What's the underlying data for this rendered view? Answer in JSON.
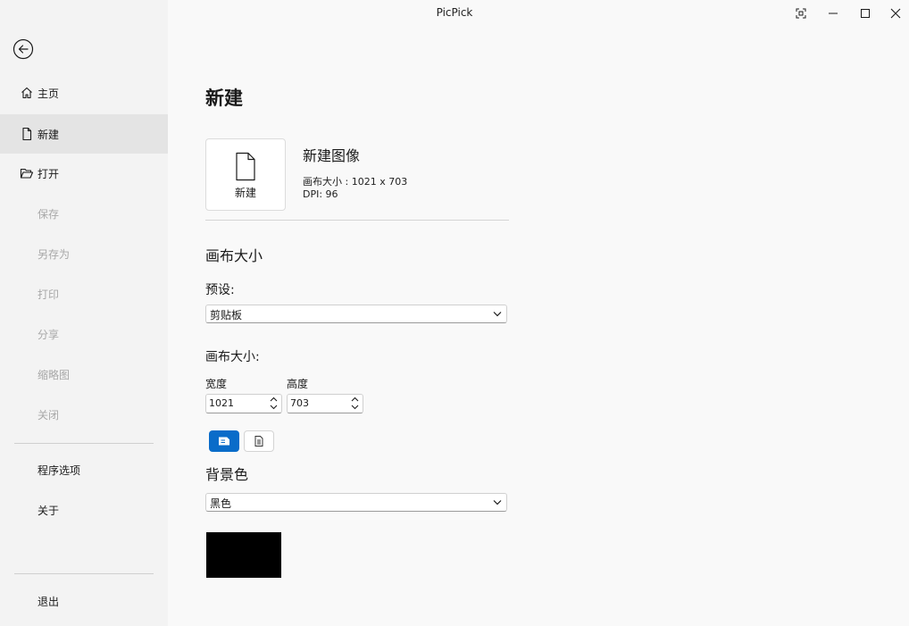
{
  "app": {
    "title": "PicPick"
  },
  "sidebar": {
    "items": [
      {
        "label": "主页",
        "icon": "home-icon",
        "state": "normal"
      },
      {
        "label": "新建",
        "icon": "new-file-icon",
        "state": "selected"
      },
      {
        "label": "打开",
        "icon": "folder-open-icon",
        "state": "normal"
      },
      {
        "label": "保存",
        "state": "disabled"
      },
      {
        "label": "另存为",
        "state": "disabled"
      },
      {
        "label": "打印",
        "state": "disabled"
      },
      {
        "label": "分享",
        "state": "disabled"
      },
      {
        "label": "缩略图",
        "state": "disabled"
      },
      {
        "label": "关闭",
        "state": "disabled"
      },
      {
        "label": "程序选项",
        "state": "normal"
      },
      {
        "label": "关于",
        "state": "normal"
      },
      {
        "label": "退出",
        "state": "normal"
      }
    ]
  },
  "main": {
    "page_title": "新建",
    "new_card": {
      "label": "新建"
    },
    "new_image": {
      "title": "新建图像",
      "canvas_size": "画布大小 : 1021 x 703",
      "dpi": "DPI: 96"
    },
    "canvas_section": {
      "title": "画布大小",
      "preset_label": "预设:",
      "preset_value": "剪贴板",
      "size_label": "画布大小:",
      "width_label": "宽度",
      "width_value": "1021",
      "height_label": "高度",
      "height_value": "703"
    },
    "background": {
      "title": "背景色",
      "value": "黑色",
      "swatch_color": "#000000"
    }
  },
  "colors": {
    "accent": "#0a6cc9",
    "selected_bg": "#e4e4e4",
    "disabled_text": "#a8a8a8"
  }
}
